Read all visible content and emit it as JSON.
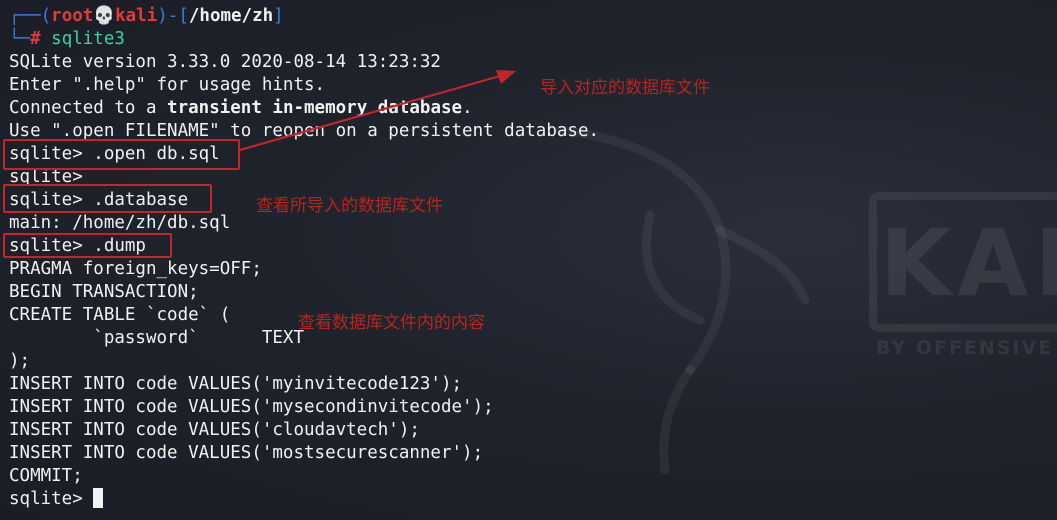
{
  "prompt": {
    "frame_top": "┌──(",
    "user": "root",
    "skull": "💀",
    "host": "kali",
    "frame_mid": ")-[",
    "cwd": "/home/zh",
    "frame_end": "]",
    "frame_bottom": "└─",
    "hash": "#",
    "command": " sqlite3"
  },
  "output": {
    "version_line": "SQLite version 3.33.0 2020-08-14 13:23:32",
    "help_line": "Enter \".help\" for usage hints.",
    "connected_prefix": "Connected to a ",
    "connected_bold": "transient in-memory database",
    "connected_suffix": ".",
    "use_line": "Use \".open FILENAME\" to reopen on a persistent database.",
    "open_cmd": "sqlite> .open db.sql",
    "blank_prompt": "sqlite>",
    "database_cmd": "sqlite> .database",
    "main_line": "main: /home/zh/db.sql",
    "dump_cmd": "sqlite> .dump",
    "pragma_line": "PRAGMA foreign_keys=OFF;",
    "begin_line": "BEGIN TRANSACTION;",
    "create_line": "CREATE TABLE `code` (",
    "column_line": "        `password`      TEXT",
    "close_line": ");",
    "insert_1": "INSERT INTO code VALUES('myinvitecode123');",
    "insert_2": "INSERT INTO code VALUES('mysecondinvitecode');",
    "insert_3": "INSERT INTO code VALUES('cloudavtech');",
    "insert_4": "INSERT INTO code VALUES('mostsecurescanner');",
    "commit_line": "COMMIT;",
    "final_prompt": "sqlite> "
  },
  "annotations": {
    "note_open": "导入对应的数据库文件",
    "note_database": "查看所导入的数据库文件",
    "note_dump": "查看数据库文件内的内容"
  },
  "watermark": {
    "wordmark": "KALI",
    "slogan": "BY OFFENSIVE SECURITY"
  },
  "colors": {
    "background": "#1d2029",
    "text": "#f2f2f2",
    "prompt_blue": "#3b7bd9",
    "prompt_red": "#e33b3b",
    "command_green": "#3fd0a2",
    "annotation_red": "#c0262c"
  }
}
